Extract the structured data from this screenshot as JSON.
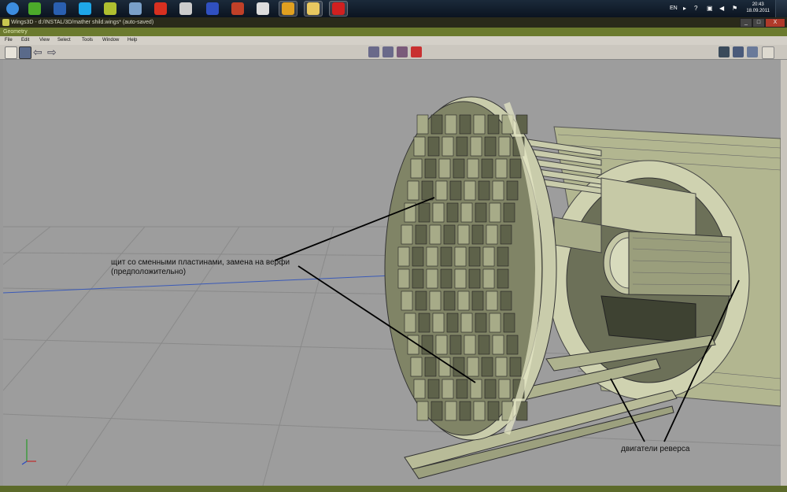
{
  "taskbar": {
    "apps": [
      {
        "name": "start-orb",
        "color": "#3c8de0"
      },
      {
        "name": "utorrent",
        "color": "#4caa2a"
      },
      {
        "name": "google-earth",
        "color": "#2a5fb0"
      },
      {
        "name": "skype",
        "color": "#1ea7e8"
      },
      {
        "name": "archive",
        "color": "#b0c030"
      },
      {
        "name": "control-panel",
        "color": "#7aa0c8"
      },
      {
        "name": "rocket",
        "color": "#d83020"
      },
      {
        "name": "phone",
        "color": "#cccccc"
      },
      {
        "name": "floppy",
        "color": "#3050c0"
      },
      {
        "name": "game",
        "color": "#c04028"
      },
      {
        "name": "alien",
        "color": "#dddddd"
      },
      {
        "name": "chrome",
        "color": "#e0a020"
      },
      {
        "name": "folder",
        "color": "#e8c860"
      },
      {
        "name": "wings3d",
        "color": "#d02020"
      }
    ],
    "language": "EN",
    "time": "20:43",
    "date": "18.09.2011"
  },
  "window": {
    "title": "Wings3D - d:/INSTAL/3D/mather shild.wings* (auto-saved)",
    "buttons": {
      "minimize": "_",
      "maximize": "□",
      "close": "X"
    }
  },
  "geometry_tab": "Geometry",
  "menu": [
    "File",
    "Edit",
    "View",
    "Select",
    "Tools",
    "Window",
    "Help"
  ],
  "toolbar": {
    "left_tools": [
      "new-file-icon",
      "save-icon",
      "undo-arrow-icon",
      "redo-arrow-icon"
    ],
    "mode_tools": [
      "vertex-select-icon",
      "edge-select-icon",
      "face-select-icon",
      "body-select-icon"
    ],
    "right_tools": [
      "window-layout-icon",
      "perspective-cube-icon",
      "ortho-cube-icon"
    ]
  },
  "annotations": {
    "shield_label_line1": "щит со сменными пластинами, замена на верфи",
    "shield_label_line2": "(предположительно)",
    "engines_label": "двигатели реверса"
  },
  "colors": {
    "model_face": "#b8bc98",
    "model_dark": "#4a4f3c",
    "viewport_bg": "#9d9d9d",
    "grid": "#8a8a8a"
  }
}
